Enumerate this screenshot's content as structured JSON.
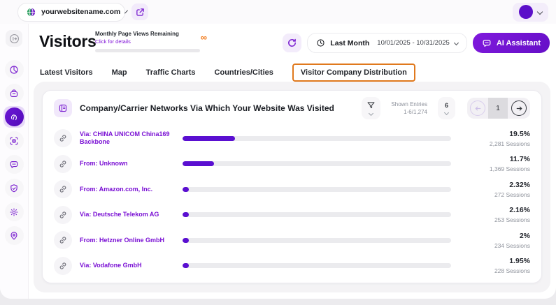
{
  "topbar": {
    "site_name": "yourwebsitename.com"
  },
  "sidebar": {
    "icons": [
      "collapse-arrow",
      "pie-chart",
      "orders-bag",
      "visitors-fingerprint",
      "target-scan",
      "chat-bubble",
      "shield-check",
      "settings-gear",
      "location-pin"
    ]
  },
  "header": {
    "title": "Visitors",
    "quota": {
      "title": "Monthly Page Views Remaining",
      "link": "Click for details",
      "value": "∞"
    },
    "period": {
      "label": "Last Month",
      "range": "10/01/2025 - 10/31/2025"
    },
    "ai_button": "AI Assistant"
  },
  "tabs": [
    {
      "label": "Latest Visitors",
      "highlighted": false
    },
    {
      "label": "Map",
      "highlighted": false
    },
    {
      "label": "Traffic Charts",
      "highlighted": false
    },
    {
      "label": "Countries/Cities",
      "highlighted": false
    },
    {
      "label": "Visitor Company Distribution",
      "highlighted": true
    }
  ],
  "card": {
    "title": "Company/Carrier Networks Via Which Your Website Was Visited",
    "shown_entries_label": "Shown Entries",
    "shown_entries_value": "1-6/1,274",
    "page_size": "6",
    "page": "1",
    "rows": [
      {
        "label": "Via: CHINA UNICOM China169 Backbone",
        "percent": "19.5%",
        "sessions": "2,281 Sessions",
        "value": 19.5
      },
      {
        "label": "From: Unknown",
        "percent": "11.7%",
        "sessions": "1,369 Sessions",
        "value": 11.7
      },
      {
        "label": "From: Amazon.com, Inc.",
        "percent": "2.32%",
        "sessions": "272 Sessions",
        "value": 2.32
      },
      {
        "label": "Via: Deutsche Telekom AG",
        "percent": "2.16%",
        "sessions": "253 Sessions",
        "value": 2.16
      },
      {
        "label": "From: Hetzner Online GmbH",
        "percent": "2%",
        "sessions": "234 Sessions",
        "value": 2.0
      },
      {
        "label": "Via: Vodafone GmbH",
        "percent": "1.95%",
        "sessions": "228 Sessions",
        "value": 1.95
      }
    ]
  },
  "colors": {
    "accent_purple": "#6a10cf",
    "bar_fill": "#5a0fd1",
    "highlight_orange": "#e0791d",
    "infinity_orange": "#f27a1a"
  }
}
